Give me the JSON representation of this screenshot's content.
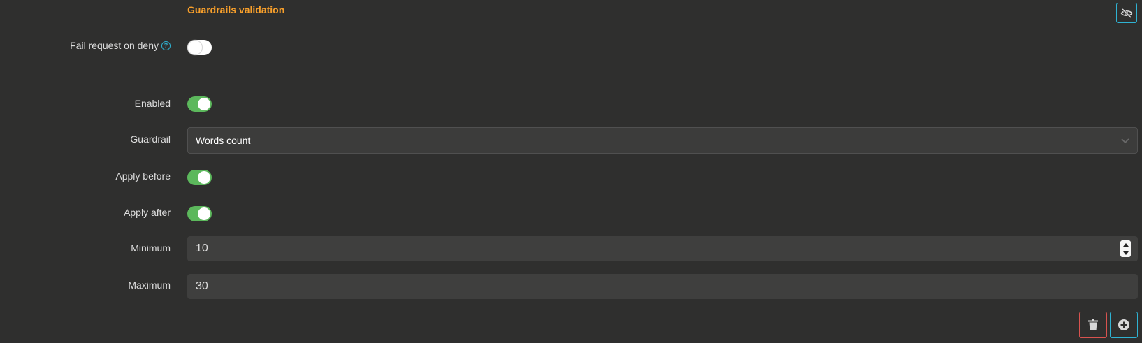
{
  "section": {
    "title": "Guardrails validation"
  },
  "fields": {
    "fail_request": {
      "label": "Fail request on deny",
      "help_icon": "question-circle-icon",
      "enabled": false
    },
    "enabled": {
      "label": "Enabled",
      "enabled": true
    },
    "guardrail": {
      "label": "Guardrail",
      "value": "Words count"
    },
    "apply_before": {
      "label": "Apply before",
      "enabled": true
    },
    "apply_after": {
      "label": "Apply after",
      "enabled": true
    },
    "minimum": {
      "label": "Minimum",
      "value": "10"
    },
    "maximum": {
      "label": "Maximum",
      "value": "30"
    }
  },
  "colors": {
    "background": "#2f2f2e",
    "title": "#f9a02b",
    "toggle_on": "#5cb85c",
    "accent": "#2fb3d3",
    "danger": "#d9534f"
  },
  "icons": {
    "hide": "eye-slash-icon",
    "delete": "trash-icon",
    "add": "plus-circle-icon",
    "dropdown": "chevron-down-icon"
  }
}
